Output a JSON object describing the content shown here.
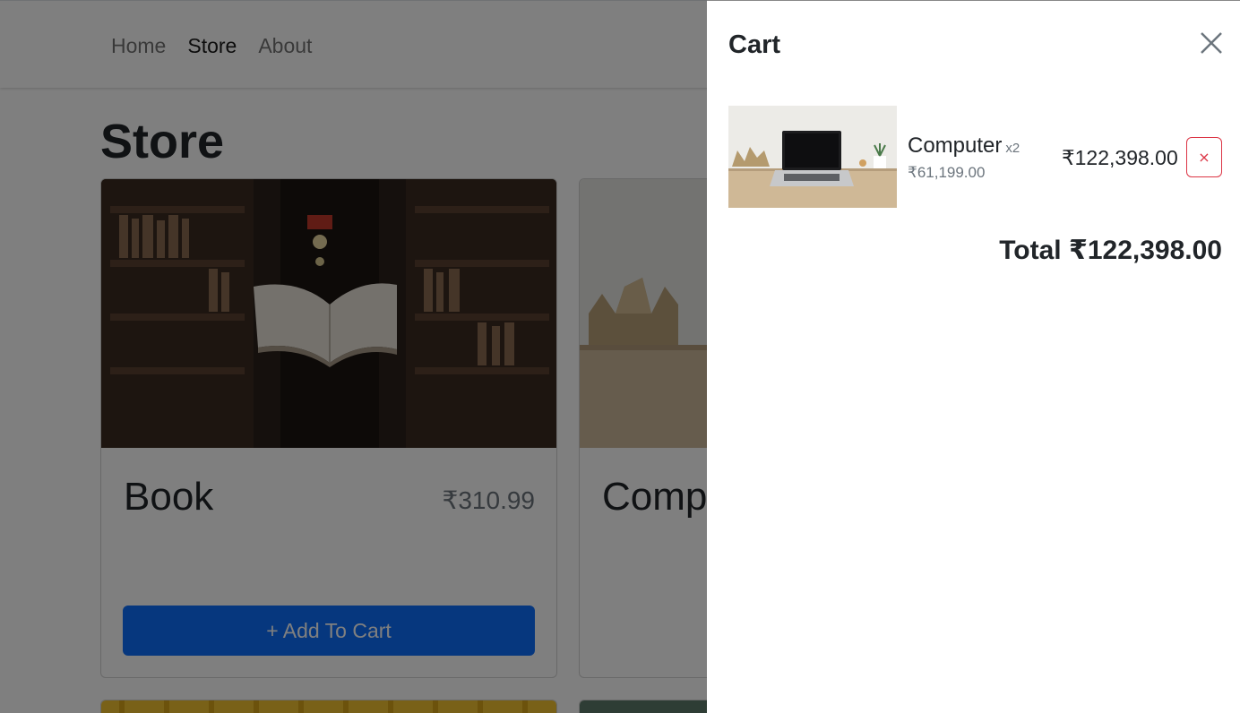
{
  "nav": {
    "links": [
      {
        "label": "Home",
        "active": false
      },
      {
        "label": "Store",
        "active": true
      },
      {
        "label": "About",
        "active": false
      }
    ]
  },
  "page": {
    "title": "Store"
  },
  "store_items": [
    {
      "name": "Book",
      "price": "₹310.99",
      "button_label": "+ Add To Cart",
      "image": "library-floating-book-photo"
    },
    {
      "name": "Computer",
      "image": "laptop-on-desk-photo"
    },
    {
      "image": "bananas-photo"
    },
    {
      "image": "car-photo"
    }
  ],
  "cart": {
    "title": "Cart",
    "items": [
      {
        "name": "Computer",
        "quantity": "x2",
        "unit_price": "₹61,199.00",
        "total_price": "₹122,398.00",
        "remove_label": "×",
        "image": "laptop-on-desk-photo"
      }
    ],
    "total_label": "Total ₹122,398.00"
  },
  "colors": {
    "primary": "#0d6efd",
    "danger": "#dc3545",
    "text": "#212529",
    "muted": "#6c757d",
    "backdrop": "rgba(0,0,0,0.5)"
  }
}
